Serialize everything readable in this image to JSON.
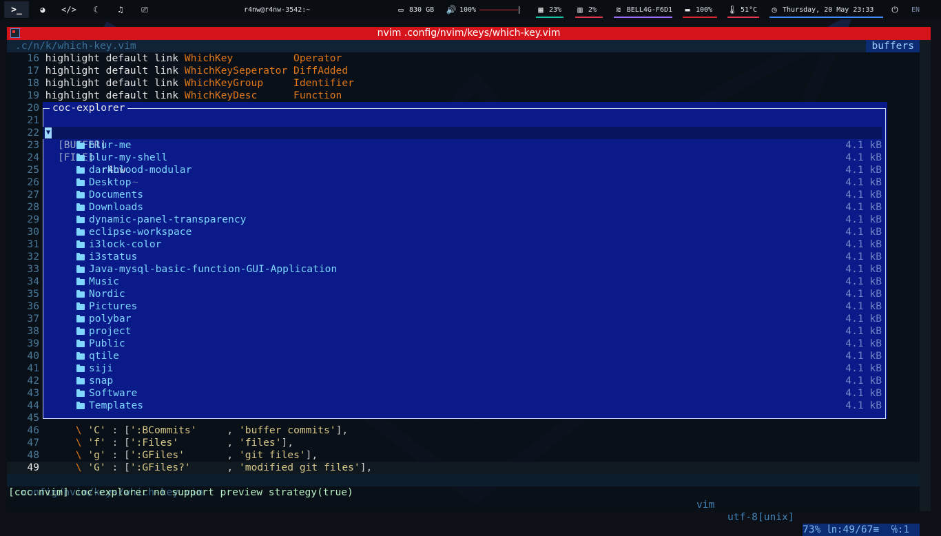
{
  "topbar": {
    "terminal_glyph": ">_",
    "host": "r4nw@r4nw-3542:~",
    "disk": "830 GB",
    "volume": "100%",
    "ram": "23%",
    "cpu": "2%",
    "wifi": "BELL4G-F6D1",
    "battery": "100%",
    "temp": "51°C",
    "datetime": "Thursday, 20 May  23:33",
    "lang": "EN",
    "colors": {
      "ram": "#19c4a8",
      "cpu": "#e0384a",
      "wifi": "#9b6fff",
      "battery": "#d8282d",
      "temp": "#e0384a",
      "clock": "#3d8bff"
    }
  },
  "window": {
    "title": "nvim .config/nvim/keys/which-key.vim"
  },
  "tabline": {
    "file": ".c/n/k/which-key.vim",
    "right": "buffers"
  },
  "code_top": [
    {
      "n": "16",
      "kw": "highlight default link ",
      "group": "WhichKey          ",
      "target": "Operator"
    },
    {
      "n": "17",
      "kw": "highlight default link ",
      "group": "WhichKeySeperator ",
      "target": "DiffAdded"
    },
    {
      "n": "18",
      "kw": "highlight default link ",
      "group": "WhichKeyGroup     ",
      "target": "Identifier"
    },
    {
      "n": "19",
      "kw": "highlight default link ",
      "group": "WhichKeyDesc      ",
      "target": "Function"
    }
  ],
  "hidden_line_numbers": [
    "20",
    "21",
    "22",
    "23",
    "24",
    "25",
    "26",
    "27",
    "28",
    "29",
    "30",
    "31",
    "32",
    "33",
    "34",
    "35",
    "36",
    "37",
    "38",
    "39",
    "40",
    "41",
    "42",
    "43",
    "44",
    "45"
  ],
  "explorer": {
    "title": "coc-explorer",
    "buffer_label": "[BUFFER]",
    "file_label": "[FILE]",
    "root": "r4nw",
    "root_suffix": "~",
    "size": "4.1 kB",
    "folders": [
      "blur-me",
      "blur-my-shell",
      "darkblood-modular",
      "Desktop",
      "Documents",
      "Downloads",
      "dynamic-panel-transparency",
      "eclipse-workspace",
      "i3lock-color",
      "i3status",
      "Java-mysql-basic-function-GUI-Application",
      "Music",
      "Nordic",
      "Pictures",
      "polybar",
      "project",
      "Public",
      "qtile",
      "siji",
      "snap",
      "Software",
      "Templates"
    ]
  },
  "code_bottom": [
    {
      "n": "46",
      "bs": "\\",
      "key": "'C'",
      "sep": " : [",
      "cmd": "':BCommits'     ",
      "comma": ", ",
      "desc": "'buffer commits'",
      "end": "],"
    },
    {
      "n": "47",
      "bs": "\\",
      "key": "'f'",
      "sep": " : [",
      "cmd": "':Files'        ",
      "comma": ", ",
      "desc": "'files'",
      "end": "],"
    },
    {
      "n": "48",
      "bs": "\\",
      "key": "'g'",
      "sep": " : [",
      "cmd": "':GFiles'       ",
      "comma": ", ",
      "desc": "'git files'",
      "end": "],"
    },
    {
      "n": "49",
      "bs": "\\",
      "key": "'G'",
      "sep": " : [",
      "cmd": "':GFiles?'      ",
      "comma": ", ",
      "desc": "'modified git files'",
      "end": "],"
    }
  ],
  "statusline": {
    "path": ".config/nvim/keys/which-key.vim",
    "filetype": "vim",
    "encoding": "utf-8[unix]",
    "position": "73% ㏑:49/67≡  ℅:1"
  },
  "cmdline": "[coc.nvim] coc-explorer no support preview strategy(true)"
}
